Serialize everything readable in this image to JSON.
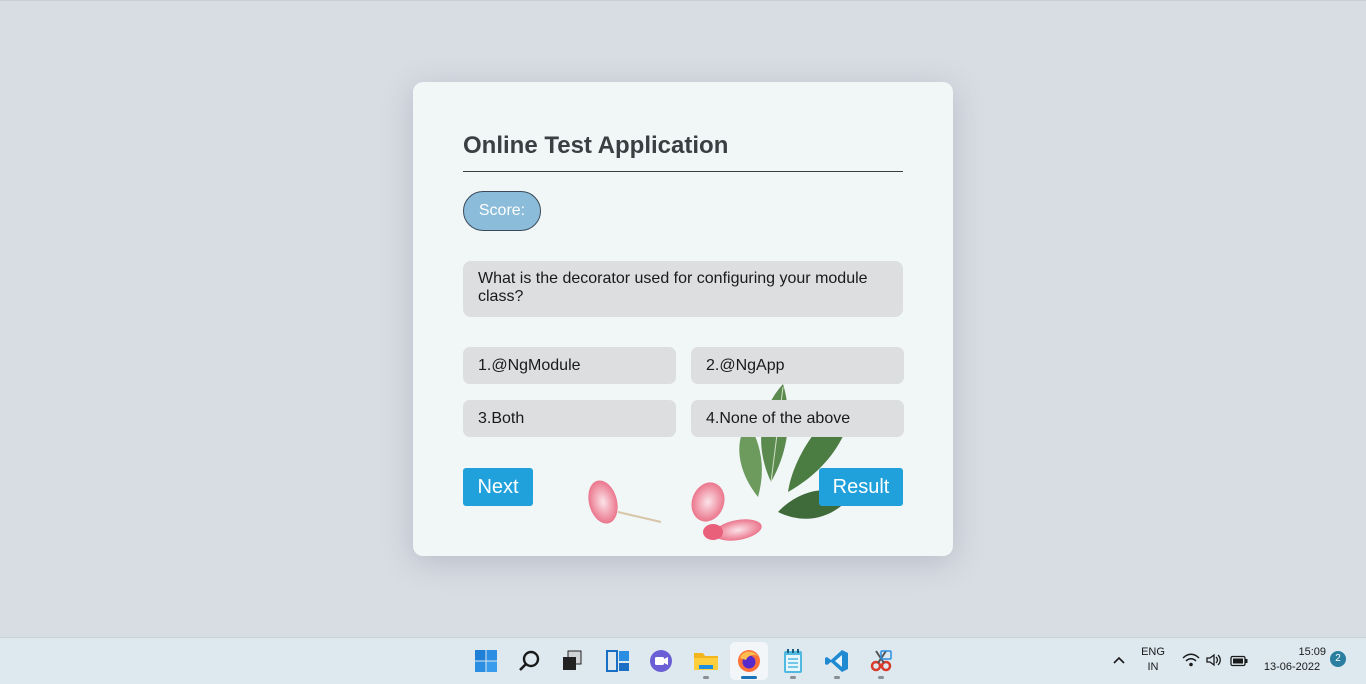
{
  "app": {
    "title": "Online Test Application",
    "score_label": "Score:",
    "question": "What is the decorator used for configuring your module class?",
    "options": [
      "1.@NgModule",
      "2.@NgApp",
      "3.Both",
      "4.None of the above"
    ],
    "next_label": "Next",
    "result_label": "Result"
  },
  "colors": {
    "accent": "#20a1db",
    "score_pill": "#8bbcd9",
    "card_bg": "#f1f6f7",
    "option_bg": "#dcdee0"
  },
  "taskbar": {
    "icons": [
      "windows-start-icon",
      "search-icon",
      "task-view-icon",
      "widgets-icon",
      "teams-chat-icon",
      "file-explorer-icon",
      "firefox-icon",
      "notepad-icon",
      "vscode-icon",
      "snipping-tool-icon"
    ],
    "tray": {
      "language": "ENG",
      "region": "IN",
      "time": "15:09",
      "date": "13-06-2022",
      "notifications": "2"
    }
  }
}
